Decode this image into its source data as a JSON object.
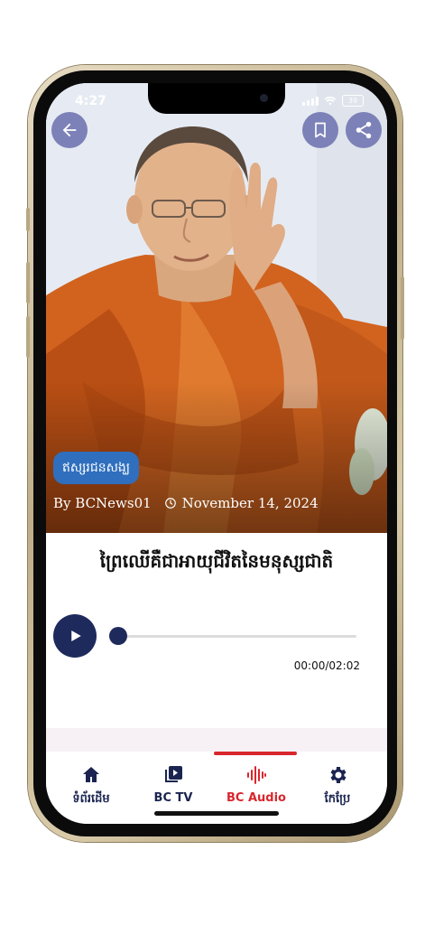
{
  "status_bar": {
    "time": "4:27",
    "battery": "39"
  },
  "article": {
    "category": "ឥស្សរជនសង្ឃ",
    "author": "By BCNews01",
    "date": "November 14, 2024",
    "title": "ព្រៃឈើគឺជាអាយុជីវិតនៃមនុស្សជាតិ"
  },
  "player": {
    "time_display": "00:00/02:02",
    "progress": 0.0
  },
  "nav": {
    "items": [
      {
        "label": "ទំព័រដើម",
        "icon": "home-icon"
      },
      {
        "label": "BC TV",
        "icon": "video-library-icon"
      },
      {
        "label": "BC Audio",
        "icon": "audio-wave-icon"
      },
      {
        "label": "កែប្រែ",
        "icon": "gear-icon"
      }
    ],
    "active_index": 2
  },
  "colors": {
    "accent": "#d9262d",
    "navy": "#1f2a5c",
    "tag": "#2f6fbd",
    "circle_button": "#7c81b8"
  }
}
